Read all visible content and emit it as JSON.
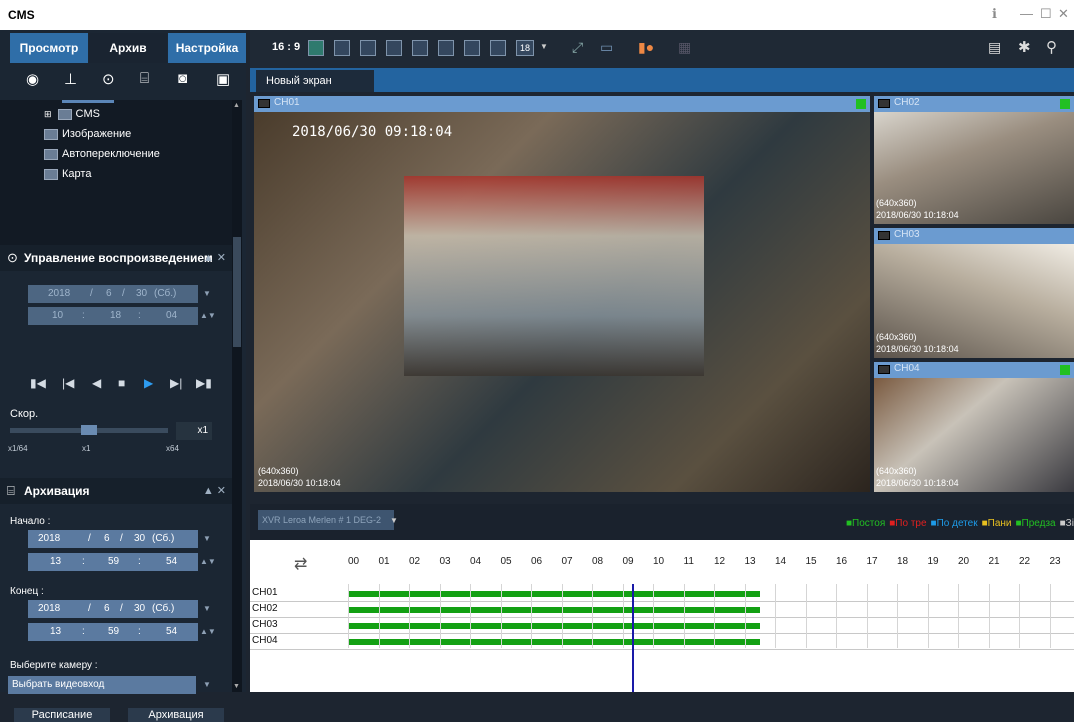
{
  "window": {
    "title": "CMS",
    "controls": [
      "ℹ",
      "—",
      "☐",
      "✕"
    ]
  },
  "nav_tabs": [
    "Просмотр",
    "Архив",
    "Настройка"
  ],
  "toolbar_icons": [
    "eye-icon",
    "computer-icon",
    "play-icon",
    "archive-icon",
    "camera-settings-icon",
    "display-icon"
  ],
  "tree": {
    "root": "CMS",
    "items": [
      "Изображение",
      "Автопереключение",
      "Карта"
    ]
  },
  "playback": {
    "title": "Управление воспроизведением",
    "date": {
      "year": "2018",
      "month": "6",
      "day": "30",
      "weekday": "(Сб.)"
    },
    "time": {
      "h": "10",
      "m": "18",
      "s": "04"
    },
    "speed_label": "Скор.",
    "speed_value": "x1",
    "speed_scale": [
      "x1/64",
      "x1",
      "x64"
    ],
    "speed_level": 0.5
  },
  "archive": {
    "title": "Архивация",
    "start_label": "Начало :",
    "start_date": {
      "year": "2018",
      "month": "6",
      "day": "30",
      "weekday": "(Сб.)"
    },
    "start_time": {
      "h": "13",
      "m": "59",
      "s": "54"
    },
    "end_label": "Конец :",
    "end_date": {
      "year": "2018",
      "month": "6",
      "day": "30",
      "weekday": "(Сб.)"
    },
    "end_time": {
      "h": "13",
      "m": "59",
      "s": "54"
    },
    "camera_label": "Выберите камеру :",
    "camera_select": "Выбрать видеовход",
    "schedule_btn": "Расписание",
    "archive_btn": "Архивация"
  },
  "main": {
    "aspect": "16 : 9",
    "layout_count": "18",
    "screen_tab": "Новый экран",
    "channels": [
      {
        "name": "CH01",
        "timestamp": "2018/06/30  09:18:04",
        "res": "(640x360)",
        "time": "2018/06/30 10:18:04"
      },
      {
        "name": "CH02",
        "res": "(640x360)",
        "time": "2018/06/30 10:18:04"
      },
      {
        "name": "CH03",
        "res": "(640x360)",
        "time": "2018/06/30 10:18:04"
      },
      {
        "name": "CH04",
        "res": "(640x360)",
        "time": "2018/06/30 10:18:04"
      }
    ]
  },
  "timeline": {
    "device": "XVR Leroa Merlen # 1 DEG-2",
    "legend": [
      {
        "label": "Постоя",
        "color": "#22c022"
      },
      {
        "label": "По тре",
        "color": "#e02020"
      },
      {
        "label": "По детек",
        "color": "#1e9be8"
      },
      {
        "label": "Пани",
        "color": "#e8c020"
      },
      {
        "label": "Предза",
        "color": "#22c022"
      },
      {
        "label": "Зі",
        "color": "#cccccc"
      }
    ],
    "hours": [
      "00",
      "01",
      "02",
      "03",
      "04",
      "05",
      "06",
      "07",
      "08",
      "09",
      "10",
      "11",
      "12",
      "13",
      "14",
      "15",
      "16",
      "17",
      "18",
      "19",
      "20",
      "21",
      "22",
      "23"
    ],
    "rows": [
      "CH01",
      "CH02",
      "CH03",
      "CH04"
    ],
    "record_end_hour": 13.5,
    "cursor_hour": 9.3
  }
}
